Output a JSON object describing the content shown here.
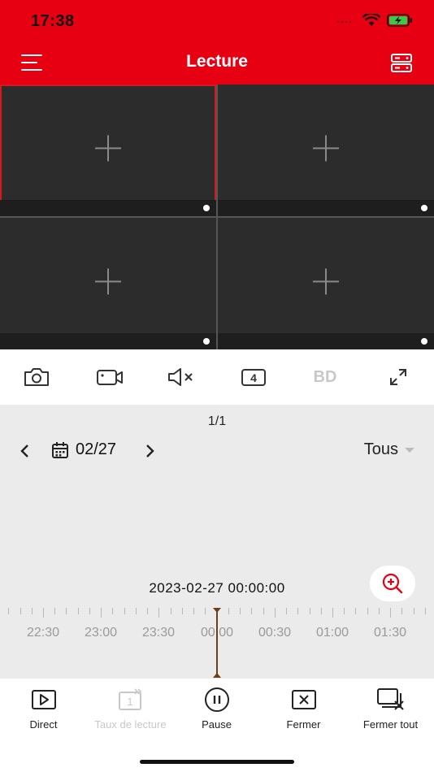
{
  "status": {
    "time": "17:38"
  },
  "header": {
    "title": "Lecture"
  },
  "toolbar": {
    "hd_label": "BD",
    "split_count": "4"
  },
  "playback": {
    "page_indicator": "1/1",
    "date": "02/27",
    "filter": "Tous",
    "timestamp": "2023-02-27 00:00:00",
    "ticks": [
      "22:30",
      "23:00",
      "23:30",
      "00:00",
      "00:30",
      "01:00",
      "01:30"
    ]
  },
  "bottom": {
    "items": [
      {
        "label": "Direct",
        "disabled": false
      },
      {
        "label": "Taux de lecture",
        "disabled": true
      },
      {
        "label": "Pause",
        "disabled": false
      },
      {
        "label": "Fermer",
        "disabled": false
      },
      {
        "label": "Fermer tout",
        "disabled": false
      }
    ]
  },
  "colors": {
    "brand": "#e60012",
    "cursor": "#6b3e1c",
    "zoom_icon": "#e60012"
  },
  "icons": [
    "menu-icon",
    "device-list-icon",
    "camera-icon",
    "record-icon",
    "mute-icon",
    "fullscreen-icon",
    "calendar-icon",
    "zoom-in-icon",
    "play-icon",
    "pause-icon",
    "close-icon",
    "close-all-icon"
  ]
}
